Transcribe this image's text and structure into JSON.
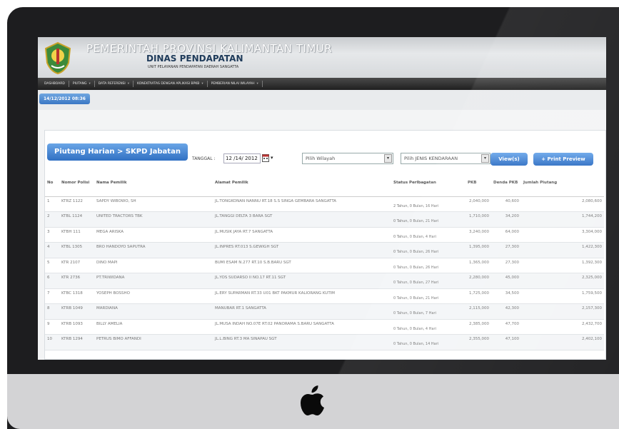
{
  "header": {
    "title": "PEMERINTAH PROVINSI KALIMANTAN TIMUR",
    "subtitle": "DINAS PENDAPATAN",
    "tagline": "UNIT PELAYANAN PENDAPATAN DAERAH SANGATTA"
  },
  "menu": {
    "items": [
      {
        "label": "DASHBOARD"
      },
      {
        "label": "PIUTANG"
      },
      {
        "label": "DATA REFERENSI"
      },
      {
        "label": "KONEKTIVITAS DENGAN APLIKASI BPKB"
      },
      {
        "label": "PEMBERIAN NILAI WILAYAH"
      }
    ]
  },
  "date_badge": "14/12/2012 08:36",
  "panel": {
    "title": "Piutang Harian > SKPD Jabatan",
    "tanggal_label": "TANGGAL :",
    "tanggal_value": "12 /14/ 2012",
    "wilayah_placeholder": "Pilih Wilayah",
    "jenis_placeholder": "Pilih JENIS KENDARAAN",
    "view_label": "View(s)",
    "print_label": "Print Preview"
  },
  "table": {
    "headers": [
      "No",
      "Nomor Polisi",
      "Nama Pemilik",
      "Alamat Pemilik",
      "Status Perlbagatan",
      "PKB",
      "Denda PKB",
      "Jumlah Piutang"
    ],
    "rows": [
      {
        "no": "1",
        "polisi": "KTRZ 1122",
        "nama": "SAPDY WIBOWO, SH",
        "alamat": "JL.TONGKONAN NANNU RT.18 S.S SINGA GEMBARA SANGATTA",
        "status": "2 Tahun, 0 Bulan, 16 Hari",
        "pkb": "2,040,000",
        "denda": "40,600",
        "jumlah": "2,080,600"
      },
      {
        "no": "2",
        "polisi": "KTBL 1124",
        "nama": "UNITED TRACTORS TBK",
        "alamat": "JL.TANGGI DELTA 3 BARA SGT",
        "status": "0 Tahun, 0 Bulan, 21 Hari",
        "pkb": "1,710,000",
        "denda": "34,200",
        "jumlah": "1,744,200"
      },
      {
        "no": "3",
        "polisi": "KTBH 111",
        "nama": "MEGA ARISKA",
        "alamat": "JL.MUSIK JAYA RT.7 SANGATTA",
        "status": "0 Tahun, 0 Bulan, 4 Hari",
        "pkb": "3,240,000",
        "denda": "64,000",
        "jumlah": "3,304,000"
      },
      {
        "no": "4",
        "polisi": "KTBL 1305",
        "nama": "BRO HANDOYO SAPUTRA",
        "alamat": "JL.INPRES RT.013 S.GEWIGH SGT",
        "status": "0 Tahun, 0 Bulan, 26 Hari",
        "pkb": "1,395,000",
        "denda": "27,300",
        "jumlah": "1,422,300"
      },
      {
        "no": "5",
        "polisi": "KTR 2107",
        "nama": "DINO MAPI",
        "alamat": "BUMI ESAM N.277 RT.10 S.B.BARU SGT",
        "status": "0 Tahun, 0 Bulan, 26 Hari",
        "pkb": "1,365,000",
        "denda": "27,300",
        "jumlah": "1,392,300"
      },
      {
        "no": "6",
        "polisi": "KTR 2736",
        "nama": "PT.TRIWIDANA",
        "alamat": "JL.YOS SUDARSO II NO.17 RT.11 SGT",
        "status": "0 Tahun, 0 Bulan, 27 Hari",
        "pkb": "2,280,000",
        "denda": "45,000",
        "jumlah": "2,325,000"
      },
      {
        "no": "7",
        "polisi": "KTBC 1318",
        "nama": "YOSEPH BOSSHO",
        "alamat": "JL.ERY SUPARMAN RT.33 U01 BKT PAKMUR KALIORANG KUTIM",
        "status": "0 Tahun, 0 Bulan, 21 Hari",
        "pkb": "1,725,000",
        "denda": "34,500",
        "jumlah": "1,759,500"
      },
      {
        "no": "8",
        "polisi": "KTRB 1049",
        "nama": "MARDIANA",
        "alamat": "MANUBAR RT.1 SANGATTA",
        "status": "0 Tahun, 0 Bulan, 7 Hari",
        "pkb": "2,115,000",
        "denda": "42,300",
        "jumlah": "2,157,300"
      },
      {
        "no": "9",
        "polisi": "KTRB 1093",
        "nama": "BILLY AMELIA",
        "alamat": "JL.MUSA INDAH NO.07E RT.02 PANORAMA S.BARU SANGATTA",
        "status": "0 Tahun, 0 Bulan, 4 Hari",
        "pkb": "2,385,000",
        "denda": "47,700",
        "jumlah": "2,432,700"
      },
      {
        "no": "10",
        "polisi": "KTRB 1294",
        "nama": "PETRUS BIMO AFFANDI",
        "alamat": "JL.L.BING RT.3 MA SINAPAU SGT",
        "status": "0 Tahun, 0 Bulan, 14 Hari",
        "pkb": "2,355,000",
        "denda": "47,100",
        "jumlah": "2,402,100"
      }
    ]
  },
  "colors": {
    "accent": "#3a77c4",
    "menu_bg": "#1f1f1f",
    "bezel": "#1d1d1f",
    "chin": "#d3d3d5"
  },
  "icons": {
    "logo": "kaltim-crest-icon",
    "calendar": "calendar-icon",
    "brand": "apple-logo-icon"
  }
}
